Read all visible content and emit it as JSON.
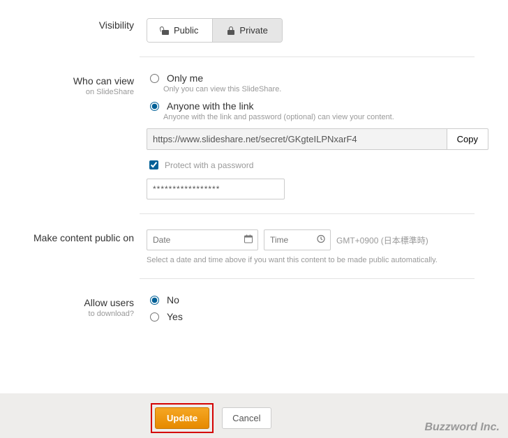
{
  "visibility": {
    "label": "Visibility",
    "public": "Public",
    "private": "Private",
    "selected": "private"
  },
  "who_can_view": {
    "label": "Who can view",
    "sublabel": "on SlideShare",
    "options": {
      "only_me": {
        "label": "Only me",
        "desc": "Only you can view this SlideShare."
      },
      "anyone_link": {
        "label": "Anyone with the link",
        "desc": "Anyone with the link and password (optional) can view your content."
      }
    },
    "link_value": "https://www.slideshare.net/secret/GKgteILPNxarF4",
    "copy_label": "Copy",
    "protect_label": "Protect with a password",
    "password_value": "*****************"
  },
  "schedule": {
    "label": "Make content public on",
    "date_placeholder": "Date",
    "time_placeholder": "Time",
    "tz": "GMT+0900 (日本標準時)",
    "hint": "Select a date and time above if you want this content to be made public automatically."
  },
  "allow_users": {
    "label": "Allow users",
    "sublabel": "to download?",
    "no": "No",
    "yes": "Yes"
  },
  "footer": {
    "update": "Update",
    "cancel": "Cancel",
    "brand": "Buzzword Inc."
  }
}
